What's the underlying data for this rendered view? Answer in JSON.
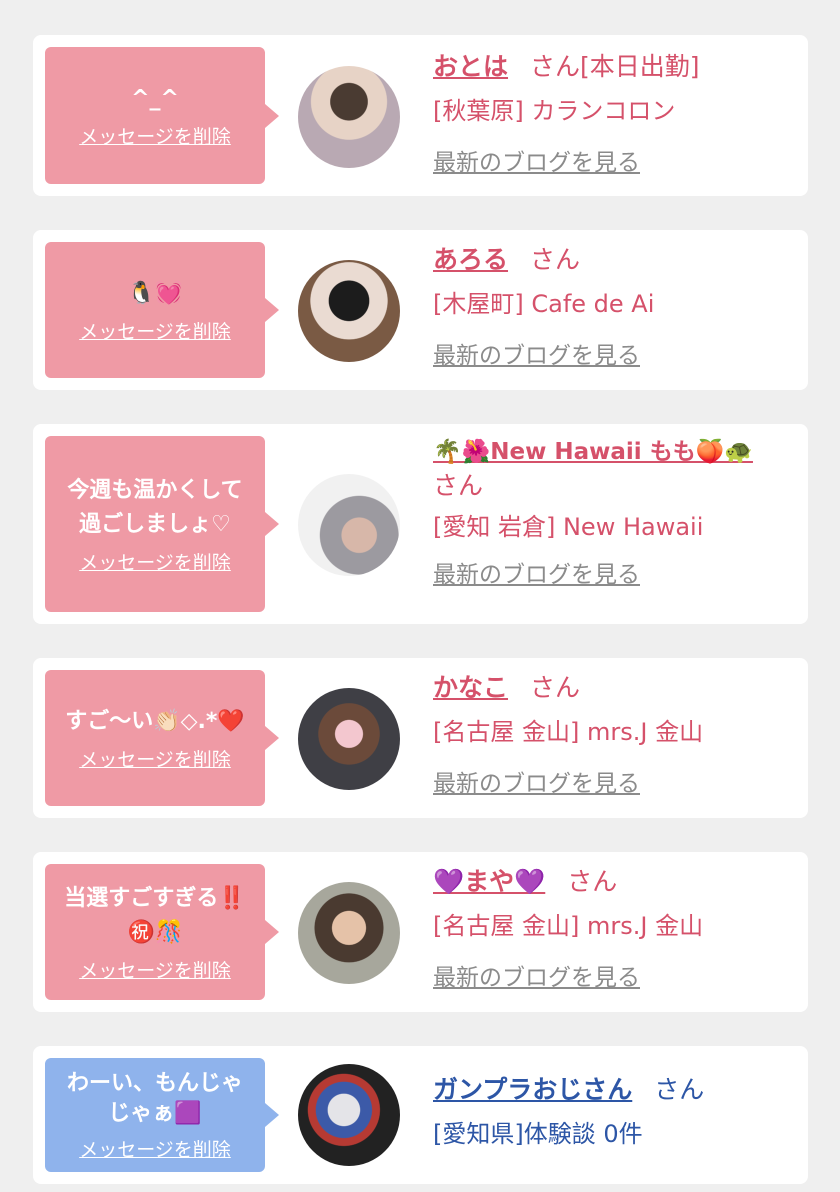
{
  "common": {
    "delete_label": "メッセージを削除",
    "san": "さん",
    "blog_label": "最新のブログを見る"
  },
  "cards": [
    {
      "message": "^_^",
      "name": "おとは",
      "suffix": "さん[本日出勤]",
      "shop": "[秋葉原] カランコロン",
      "bubble_color": "pink"
    },
    {
      "message": "🐧💓",
      "name": "あろる",
      "suffix": "さん",
      "shop": "[木屋町] Cafe de Ai",
      "bubble_color": "pink"
    },
    {
      "message": "今週も温かくして\n過ごしましょ♡",
      "name": "🌴🌺New Hawaii もも🍑🐢",
      "suffix": "さん",
      "shop": "[愛知 岩倉] New Hawaii",
      "bubble_color": "pink"
    },
    {
      "message": "すご〜い👏🏻◇.*❤️",
      "name": "かなこ",
      "suffix": "さん",
      "shop": "[名古屋 金山] mrs.J 金山",
      "bubble_color": "pink"
    },
    {
      "message": "当選すごすぎる‼️\n㊗️🎊",
      "name": "💜まや💜",
      "suffix": "さん",
      "shop": "[名古屋 金山] mrs.J 金山",
      "bubble_color": "pink"
    },
    {
      "message": "わーい、もんじゃ\nじゃぁ🟪",
      "name": "ガンプラおじさん",
      "suffix": "さん",
      "shop": "[愛知県]体験談 0件",
      "bubble_color": "blue"
    }
  ],
  "colors": {
    "pink_bubble": "#ef9aa5",
    "blue_bubble": "#8fb3ec",
    "name_pink": "#d5516a",
    "name_blue": "#2d56a6",
    "link_gray": "#8b8b8b"
  }
}
